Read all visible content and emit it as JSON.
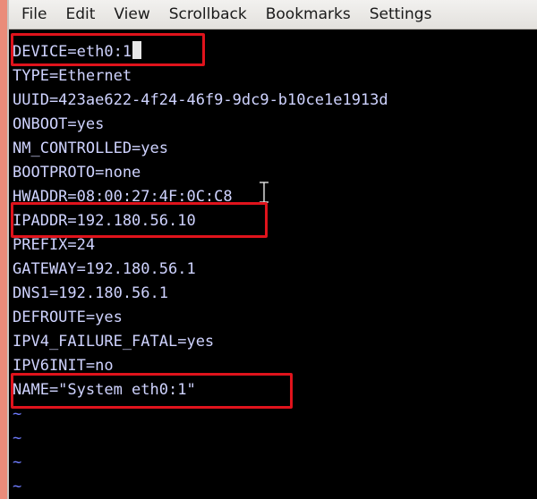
{
  "menu": [
    "File",
    "Edit",
    "View",
    "Scrollback",
    "Bookmarks",
    "Settings"
  ],
  "lines": [
    "DEVICE=eth0:1",
    "TYPE=Ethernet",
    "UUID=423ae622-4f24-46f9-9dc9-b10ce1e1913d",
    "ONBOOT=yes",
    "NM_CONTROLLED=yes",
    "BOOTPROTO=none",
    "HWADDR=08:00:27:4F:0C:C8",
    "IPADDR=192.180.56.10",
    "PREFIX=24",
    "GATEWAY=192.180.56.1",
    "DNS1=192.180.56.1",
    "DEFROUTE=yes",
    "IPV4_FAILURE_FATAL=yes",
    "IPV6INIT=no",
    "NAME=\"System eth0:1\"",
    "~",
    "~",
    "~",
    "~"
  ],
  "colors": {
    "terminal_bg": "#000000",
    "text": "#cfd3ff",
    "tilde": "#6f7cff",
    "highlight": "#e0131c",
    "menubar": "#e9e8e5"
  },
  "icons": [
    "text-cursor-ibeam-icon"
  ]
}
